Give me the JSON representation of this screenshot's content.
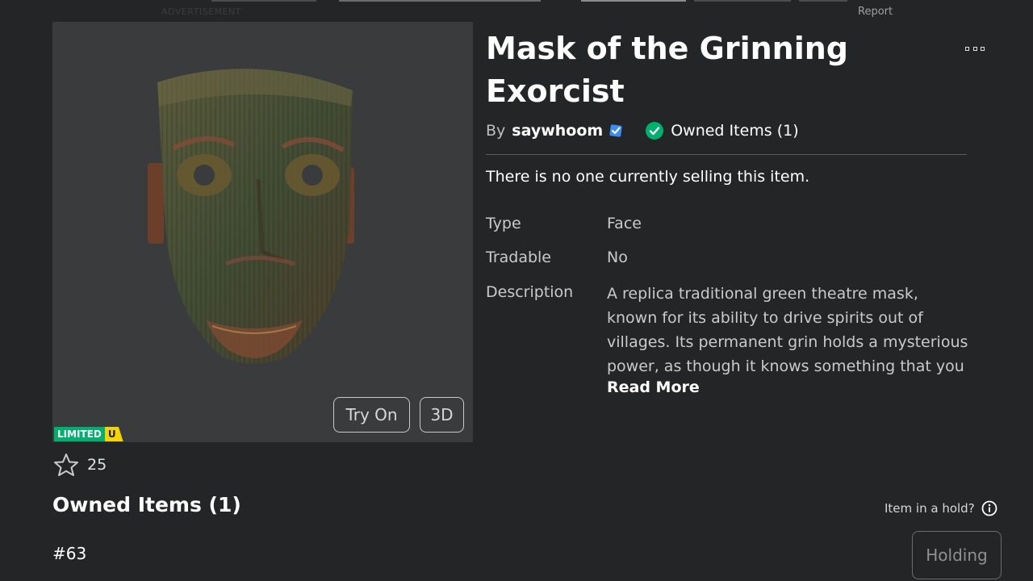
{
  "ad": {
    "label": "ADVERTISEMENT"
  },
  "report": "Report",
  "item": {
    "title": "Mask of the Grinning Exorcist",
    "by_label": "By",
    "creator": "saywhoom",
    "owned_label": "Owned Items (1)",
    "no_sellers": "There is no one currently selling this item.",
    "details": [
      {
        "key": "Type",
        "value": "Face"
      },
      {
        "key": "Tradable",
        "value": "No"
      },
      {
        "key": "Description",
        "value": "A replica traditional green theatre mask,\nknown for its ability to drive spirits out of\nvillages. Its permanent grin holds a mysterious\npower, as though it knows something that you"
      }
    ],
    "read_more": "Read More"
  },
  "thumbnail": {
    "try_on": "Try On",
    "view_3d": "3D",
    "badge_limited": "LIMITED",
    "badge_u": "U"
  },
  "favorites": {
    "count": "25",
    "icon": "star-outline-icon"
  },
  "owned_section": {
    "heading": "Owned Items (1)",
    "serial": "#63",
    "hold_question": "Item in a hold?",
    "holding_button": "Holding"
  },
  "colors": {
    "background": "#232527",
    "panel": "#393b3d",
    "limited_green": "#00b06f",
    "limited_yellow": "#f5d400",
    "verified_blue": "#3b8cf4",
    "owned_green": "#00b06f"
  }
}
